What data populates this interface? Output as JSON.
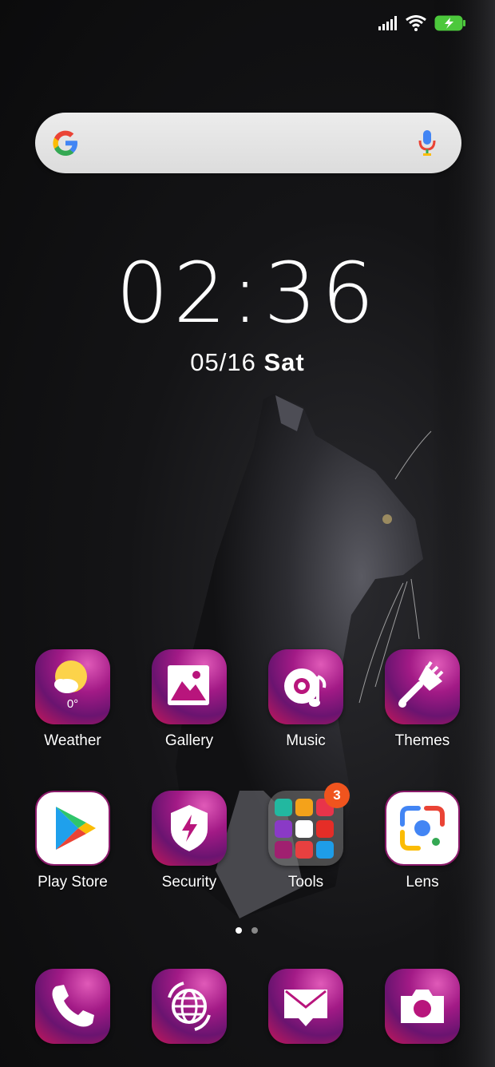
{
  "status_bar": {
    "icons": [
      "signal-icon",
      "wifi-icon",
      "battery-charging-icon"
    ]
  },
  "search": {
    "logo": "google-g-icon",
    "mic": "mic-icon"
  },
  "clock": {
    "time": "02:36"
  },
  "date": {
    "date": "05/16",
    "weekday": "Sat"
  },
  "home_apps": [
    {
      "label": "Weather",
      "temp": "0°"
    },
    {
      "label": "Gallery"
    },
    {
      "label": "Music"
    },
    {
      "label": "Themes"
    },
    {
      "label": "Play Store"
    },
    {
      "label": "Security"
    },
    {
      "label": "Tools",
      "badge": "3"
    },
    {
      "label": "Lens"
    }
  ],
  "page_indicator": {
    "pages": 2,
    "current": 1
  },
  "dock": [
    "phone-icon",
    "browser-icon",
    "messages-icon",
    "camera-icon"
  ]
}
